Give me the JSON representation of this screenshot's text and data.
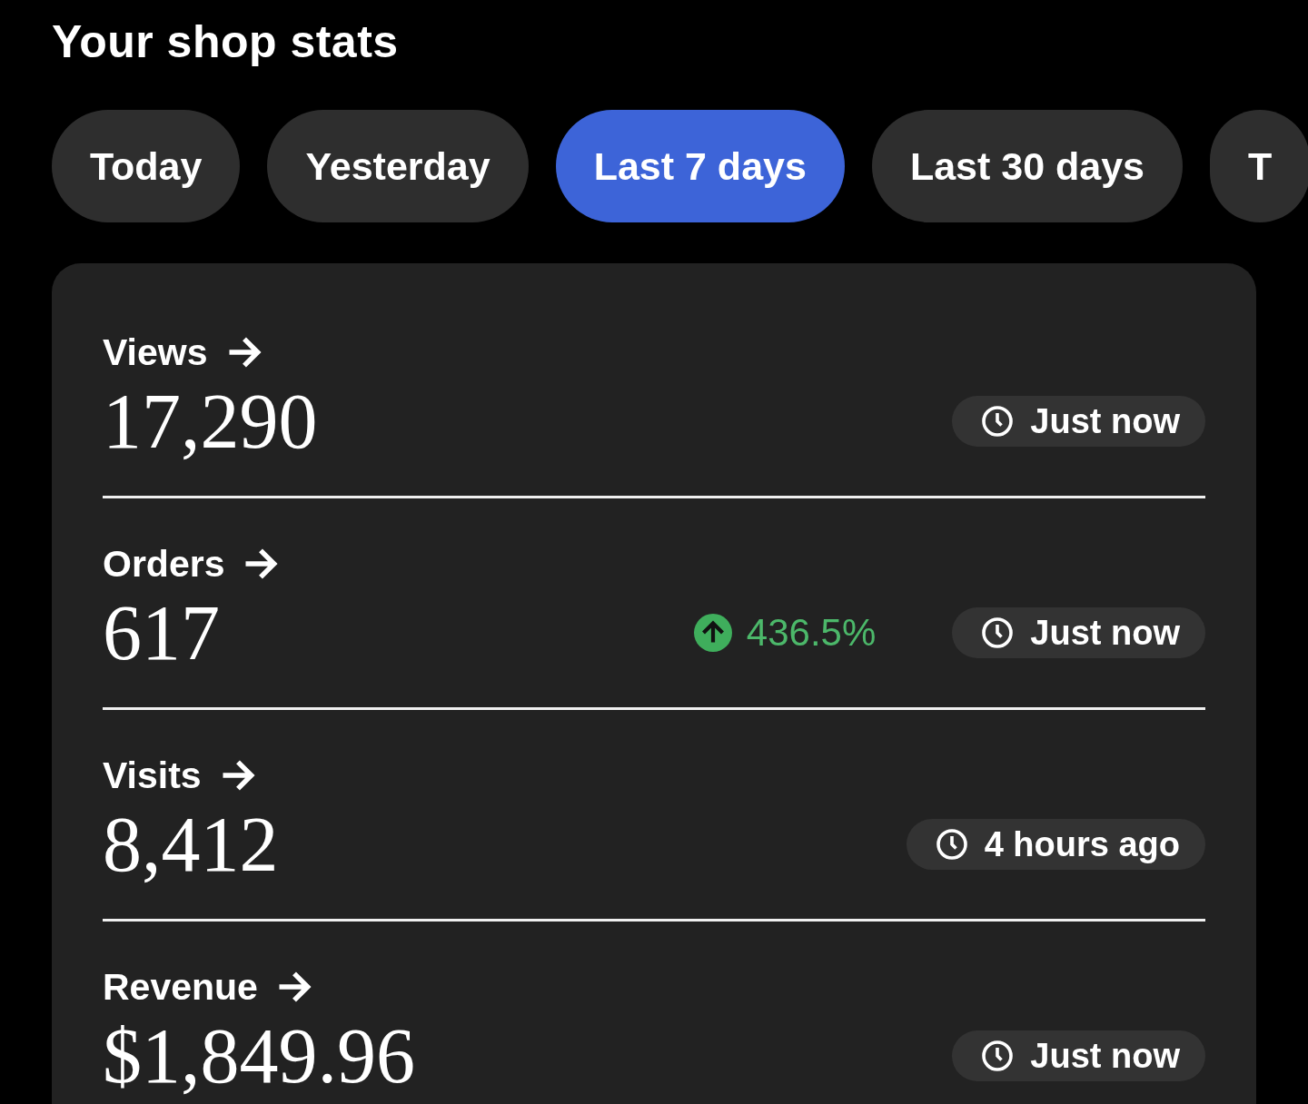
{
  "title": "Your shop stats",
  "tabs": [
    {
      "label": "Today",
      "selected": false
    },
    {
      "label": "Yesterday",
      "selected": false
    },
    {
      "label": "Last 7 days",
      "selected": true
    },
    {
      "label": "Last 30 days",
      "selected": false
    },
    {
      "label": "T",
      "selected": false
    }
  ],
  "metrics": [
    {
      "label": "Views",
      "value": "17,290",
      "updated": "Just now"
    },
    {
      "label": "Orders",
      "value": "617",
      "change": "436.5%",
      "rising": true,
      "updated": "Just now"
    },
    {
      "label": "Visits",
      "value": "8,412",
      "updated": "4 hours ago"
    },
    {
      "label": "Revenue",
      "value": "$1,849.96",
      "updated": "Just now"
    }
  ]
}
